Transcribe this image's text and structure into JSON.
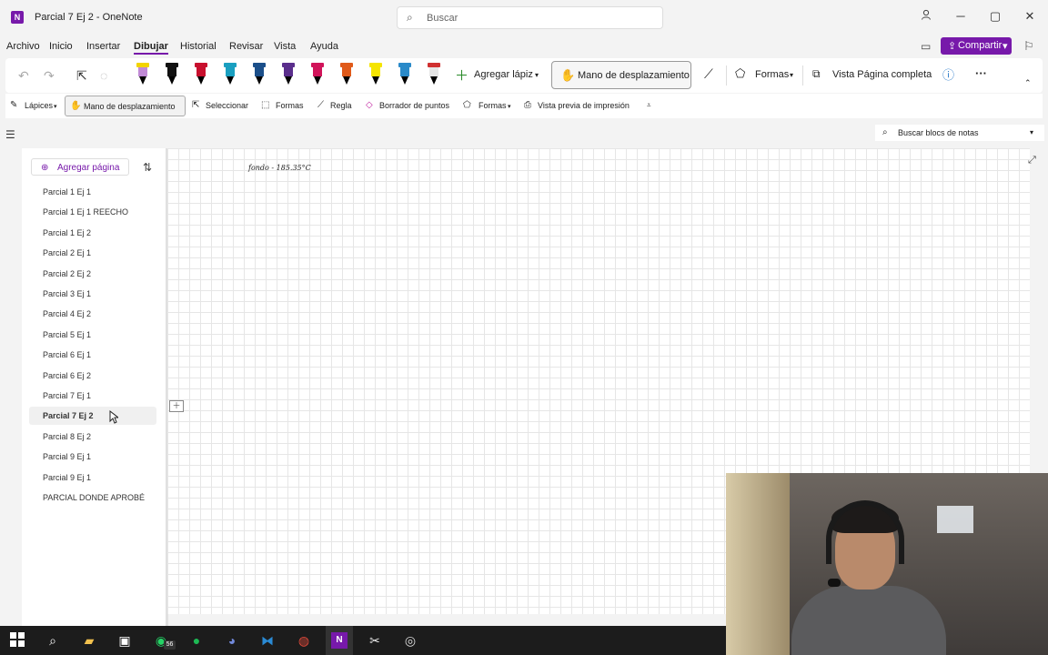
{
  "window": {
    "app_icon": "N",
    "title": "Parcial 7 Ej 2  -  OneNote",
    "search_placeholder": "Buscar",
    "controls": {
      "account": "person-icon",
      "minimize": "─",
      "maximize": "▢",
      "close": "✕"
    }
  },
  "menu": {
    "items": [
      "Archivo",
      "Inicio",
      "Insertar",
      "Dibujar",
      "Historial",
      "Revisar",
      "Vista",
      "Ayuda"
    ],
    "active": "Dibujar",
    "share_label": "Compartir"
  },
  "ribbon": {
    "add_pen": "Agregar lápiz",
    "hand": "Mano de desplazamiento",
    "shapes": "Formas",
    "full_page": "Vista Página completa",
    "more": "···",
    "pens": [
      {
        "color": "#c18ad6",
        "band": "#f3d400"
      },
      {
        "color": "#111111",
        "band": "#111111"
      },
      {
        "color": "#c8102e",
        "band": "#c8102e"
      },
      {
        "color": "#1a9fc0",
        "band": "#1a9fc0"
      },
      {
        "color": "#1b4f8a",
        "band": "#1b4f8a"
      },
      {
        "color": "#5a2e8c",
        "band": "#5a2e8c"
      },
      {
        "color": "#d1145a",
        "band": "#d1145a"
      },
      {
        "color": "#e05a1a",
        "band": "#e05a1a"
      },
      {
        "color": "#f5e400",
        "band": "#f5e400"
      },
      {
        "color": "#2a8ac9",
        "band": "#2a8ac9"
      },
      {
        "color": "#e6e6e6",
        "band": "#d03030"
      }
    ]
  },
  "subbar": {
    "pencils": "Lápices",
    "hand": "Mano de desplazamiento",
    "select": "Seleccionar",
    "shapes": "Formas",
    "ruler": "Regla",
    "point_eraser": "Borrador de puntos",
    "shapes2": "Formas",
    "print_preview": "Vista previa de impresión"
  },
  "notebook_search": "Buscar blocs de notas",
  "pages": {
    "add_label": "Agregar página",
    "items": [
      "Parcial 1 Ej 1",
      "Parcial 1  Ej 1 REECHO",
      "Parcial 1 Ej 2",
      "Parcial 2 Ej 1",
      "Parcial 2 Ej 2",
      "Parcial 3 Ej 1",
      "Parcial 4 Ej 2",
      "Parcial 5 Ej 1",
      "Parcial 6 Ej 1",
      "Parcial 6 Ej 2",
      "Parcial 7 Ej 1",
      "Parcial 7 Ej 2",
      "Parcial 8 Ej 2",
      "Parcial 9 Ej 1",
      "Parcial 9 Ej 1",
      "PARCIAL DONDE APROBÉ"
    ],
    "selected_index": 11
  },
  "canvas": {
    "ink_note": "fondo - 185.35°C"
  },
  "taskbar": {
    "badge": "56",
    "icons": [
      "windows-start-icon",
      "search-icon",
      "file-explorer-icon",
      "store-icon",
      "whatsapp-icon",
      "spotify-icon",
      "discord-icon",
      "vscode-icon",
      "chrome-icon",
      "onenote-icon",
      "snip-icon",
      "obs-icon"
    ]
  }
}
